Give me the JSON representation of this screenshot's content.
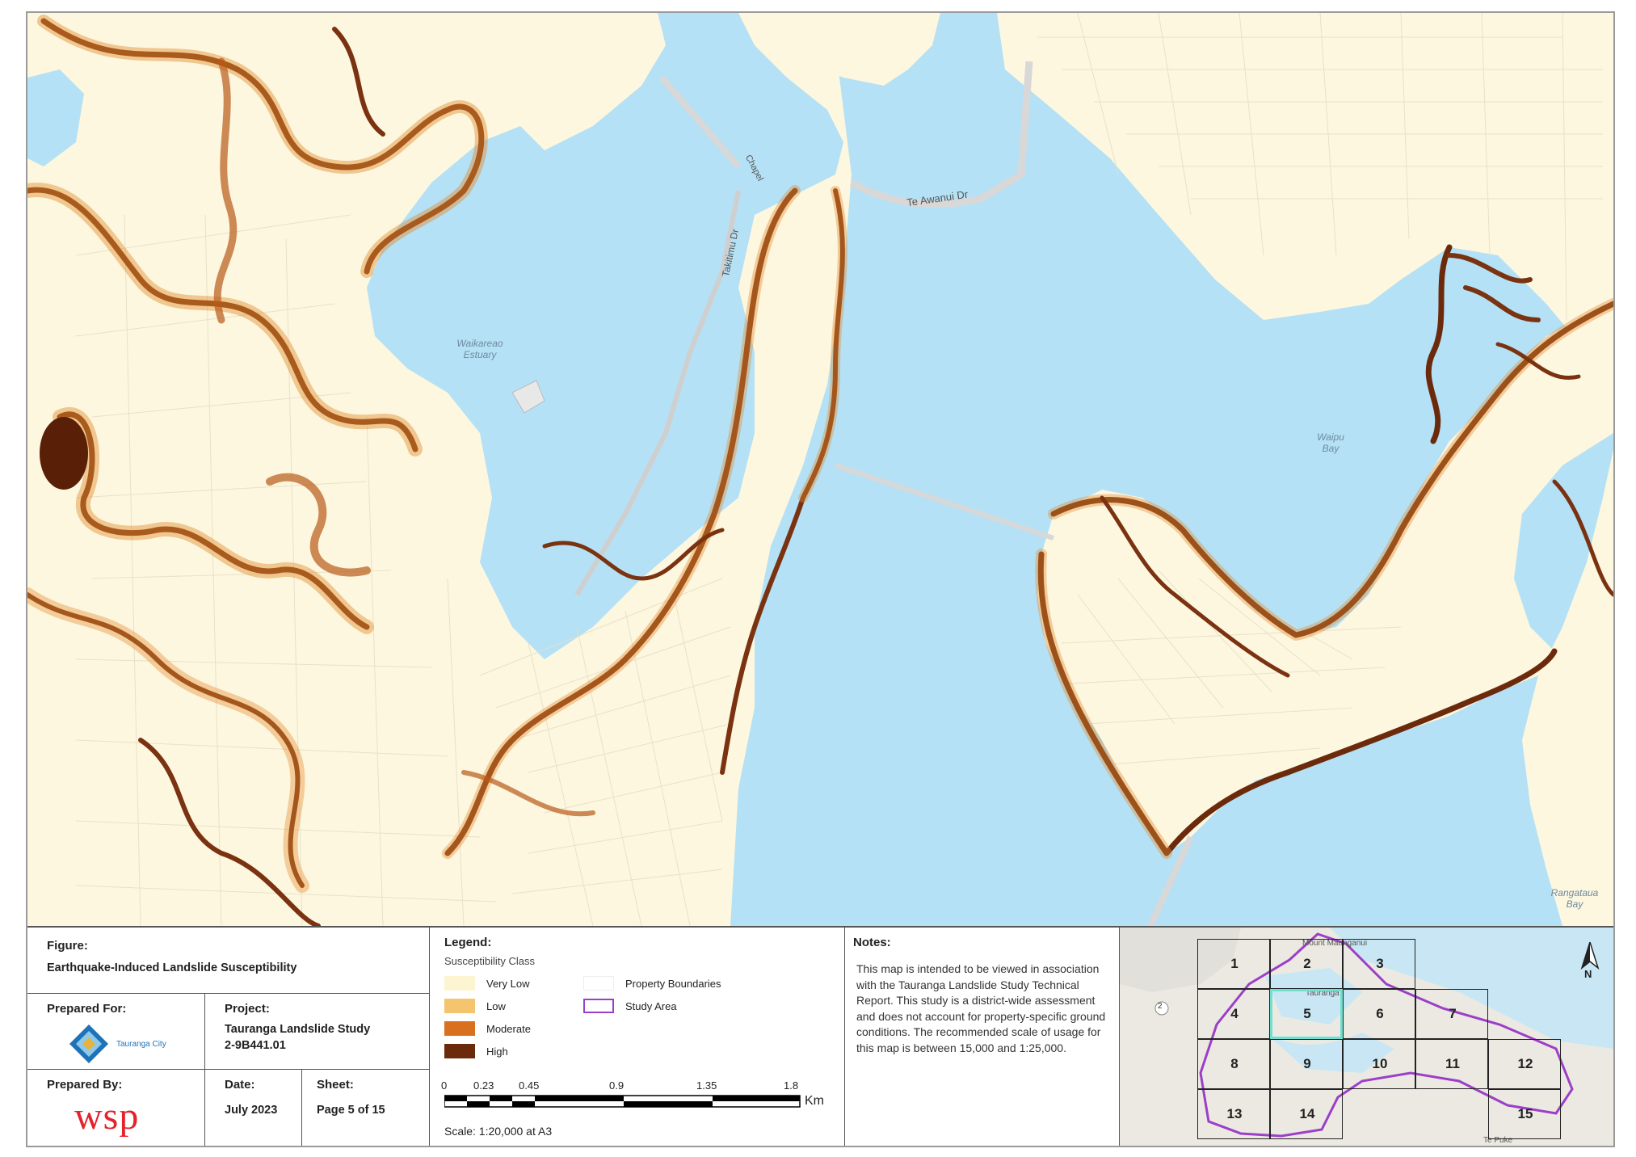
{
  "map": {
    "labels": {
      "waikareao": "Waikareao Estuary",
      "waipu": "Waipu Bay",
      "rangataua": "Rangataua Bay"
    },
    "roads": {
      "te_awanui": "Te Awanui Dr",
      "takitimu": "Takitimu Dr",
      "chapel": "Chapel"
    },
    "colors": {
      "water": "#b4e1f5",
      "land": "#fdf7e0",
      "very_low": "#fdf5d2",
      "low": "#f5c46e",
      "moderate": "#d9701f",
      "high": "#6b2a0b",
      "study_area": "#9b3fc8",
      "highlight": "#6fe0d0"
    }
  },
  "title_block": {
    "figure_label": "Figure:",
    "figure_title": "Earthquake-Induced Landslide Susceptibility",
    "prepared_for_label": "Prepared For:",
    "client_name": "Tauranga City",
    "project_label": "Project:",
    "project_name": "Tauranga Landslide Study",
    "project_number": "2-9B441.01",
    "prepared_by_label": "Prepared By:",
    "prepared_by_logo": "wsp",
    "date_label": "Date:",
    "date_value": "July 2023",
    "sheet_label": "Sheet:",
    "sheet_value": "Page 5 of 15",
    "legend": {
      "heading": "Legend:",
      "class_title": "Susceptibility Class",
      "items": [
        "Very Low",
        "Low",
        "Moderate",
        "High"
      ],
      "property_boundaries": "Property Boundaries",
      "study_area": "Study Area"
    },
    "scale": {
      "ticks": [
        "0",
        "0.23",
        "0.45",
        "0.9",
        "1.35",
        "1.8"
      ],
      "unit": "Km",
      "text": "Scale: 1:20,000 at A3"
    },
    "notes": {
      "heading": "Notes:",
      "text": "This map is intended to be viewed in association with the Tauranga Landslide Study Technical Report. This study is a district-wide assessment and does not account for property-specific ground conditions. The recommended scale of usage for this map is between 15,000 and 1:25,000."
    },
    "inset": {
      "sheets": [
        "1",
        "2",
        "3",
        "4",
        "5",
        "6",
        "7",
        "8",
        "9",
        "10",
        "11",
        "12",
        "13",
        "14",
        "15"
      ],
      "current_sheet": "5",
      "north": "N",
      "place_labels": [
        "Mount Maunganui",
        "Tauranga",
        "Te Puke"
      ],
      "highway": "2"
    }
  }
}
